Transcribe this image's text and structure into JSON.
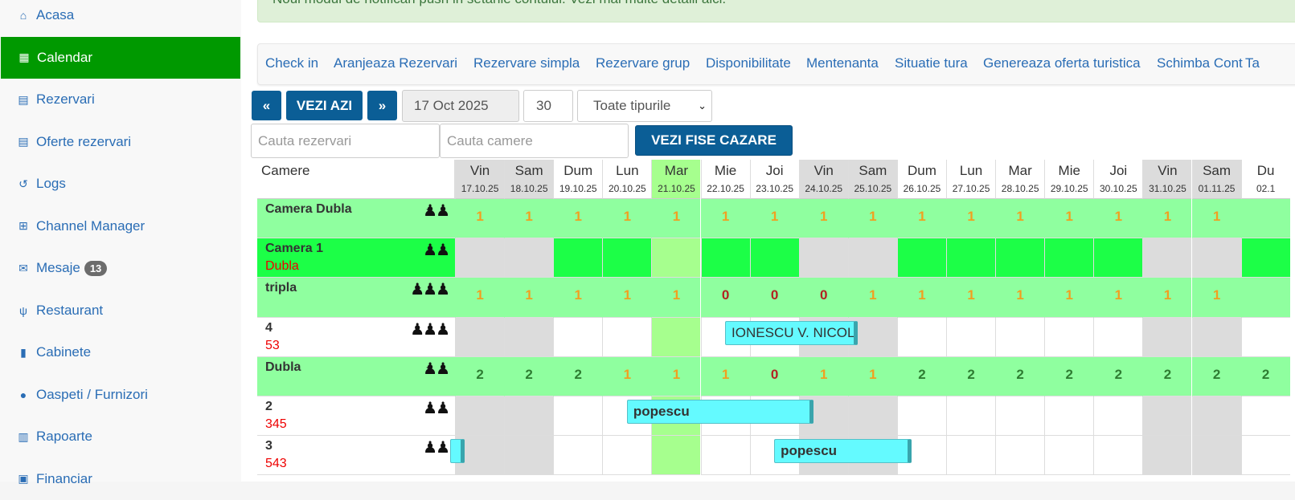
{
  "sidebar": {
    "items": [
      {
        "label": "Acasa",
        "icon": "home-icon",
        "glyph": "⌂"
      },
      {
        "label": "Calendar",
        "icon": "table-icon",
        "glyph": "▦"
      },
      {
        "label": "Rezervari",
        "icon": "id-card-icon",
        "glyph": "▤"
      },
      {
        "label": "Oferte rezervari",
        "icon": "id-card-icon",
        "glyph": "▤"
      },
      {
        "label": "Logs",
        "icon": "history-icon",
        "glyph": "↺"
      },
      {
        "label": "Channel Manager",
        "icon": "sitemap-icon",
        "glyph": "⊞"
      },
      {
        "label": "Mesaje",
        "icon": "envelope-icon",
        "glyph": "✉",
        "badge": "13"
      },
      {
        "label": "Restaurant",
        "icon": "cutlery-icon",
        "glyph": "ψ"
      },
      {
        "label": "Cabinete",
        "icon": "book-icon",
        "glyph": "▮"
      },
      {
        "label": "Oaspeti / Furnizori",
        "icon": "user-icon",
        "glyph": "●"
      },
      {
        "label": "Rapoarte",
        "icon": "bar-chart-icon",
        "glyph": "▥"
      },
      {
        "label": "Financiar",
        "icon": "money-icon",
        "glyph": "▣"
      }
    ]
  },
  "alert": {
    "text": "Noul modul de notificari push in setarile contului. Vezi mai multe detalii aici."
  },
  "menu": [
    "Check in",
    "Aranjeaza Rezervari",
    "Rezervare simpla",
    "Rezervare grup",
    "Disponibilitate",
    "Mentenanta",
    "Situatie tura",
    "Genereaza oferta turistica",
    "Schimba Cont",
    "Ta"
  ],
  "toolbar": {
    "prev_label": "«",
    "today_label": "VEZI AZI",
    "next_label": "»",
    "date_value": "17 Oct 2025",
    "days_value": "30",
    "type_select": "Toate tipurile",
    "search_reservations_placeholder": "Cauta rezervari",
    "search_rooms_placeholder": "Cauta camere",
    "fise_label": "VEZI FISE CAZARE"
  },
  "colors": {
    "accent_green": "#009900",
    "nav_blue": "#0b5e96",
    "row_type": "#8fff9f",
    "row_room_free": "#1cff47",
    "weekend": "#dcdcdc",
    "today": "#a6ff8e",
    "booking": "#64faff",
    "yellow_num": "#f0a020",
    "red_num": "#b22222",
    "green_num": "#2e7d32"
  },
  "calendar": {
    "rooms_header": "Camere",
    "days": [
      {
        "day": "Vin",
        "date": "17.10.25"
      },
      {
        "day": "Sam",
        "date": "18.10.25"
      },
      {
        "day": "Dum",
        "date": "19.10.25"
      },
      {
        "day": "Lun",
        "date": "20.10.25"
      },
      {
        "day": "Mar",
        "date": "21.10.25"
      },
      {
        "day": "Mie",
        "date": "22.10.25"
      },
      {
        "day": "Joi",
        "date": "23.10.25"
      },
      {
        "day": "Vin",
        "date": "24.10.25"
      },
      {
        "day": "Sam",
        "date": "25.10.25"
      },
      {
        "day": "Dum",
        "date": "26.10.25"
      },
      {
        "day": "Lun",
        "date": "27.10.25"
      },
      {
        "day": "Mar",
        "date": "28.10.25"
      },
      {
        "day": "Mie",
        "date": "29.10.25"
      },
      {
        "day": "Joi",
        "date": "30.10.25"
      },
      {
        "day": "Vin",
        "date": "31.10.25"
      },
      {
        "day": "Sam",
        "date": "01.11.25"
      },
      {
        "day": "Du",
        "date": "02.1"
      }
    ],
    "weekend_cols": [
      0,
      1,
      7,
      8,
      14,
      15
    ],
    "today_col": 4,
    "rows": [
      {
        "kind": "type",
        "name": "Camera Dubla",
        "people": "🯅🯅",
        "capacity": 2,
        "counts": [
          "1",
          "1",
          "1",
          "1",
          "1",
          "1",
          "1",
          "1",
          "1",
          "1",
          "1",
          "1",
          "1",
          "1",
          "1",
          "1",
          ""
        ]
      },
      {
        "kind": "room-green",
        "name": "Camera 1",
        "sub": "Dubla",
        "capacity": 2
      },
      {
        "kind": "type",
        "name": "tripla",
        "capacity": 3,
        "counts": [
          "1",
          "1",
          "1",
          "1",
          "1",
          "0",
          "0",
          "0",
          "1",
          "1",
          "1",
          "1",
          "1",
          "1",
          "1",
          "1",
          ""
        ]
      },
      {
        "kind": "room",
        "name": "4",
        "sub": "53",
        "capacity": 3
      },
      {
        "kind": "type",
        "name": "Dubla",
        "capacity": 2,
        "counts": [
          "2",
          "2",
          "2",
          "1",
          "1",
          "1",
          "0",
          "1",
          "1",
          "2",
          "2",
          "2",
          "2",
          "2",
          "2",
          "2",
          "2"
        ]
      },
      {
        "kind": "room",
        "name": "2",
        "sub": "345",
        "capacity": 2
      },
      {
        "kind": "room",
        "name": "3",
        "sub": "543",
        "capacity": 2
      }
    ],
    "bookings": [
      {
        "row": 3,
        "start": 5.5,
        "end": 8.2,
        "label": "IONESCU V. NICOLAE",
        "bold": false
      },
      {
        "row": 5,
        "start": 3.5,
        "end": 7.3,
        "label": "popescu",
        "bold": true
      },
      {
        "row": 6,
        "start": -0.1,
        "end": 0.2,
        "label": "",
        "bold": false
      },
      {
        "row": 6,
        "start": 6.5,
        "end": 9.3,
        "label": "popescu",
        "bold": true
      }
    ]
  }
}
